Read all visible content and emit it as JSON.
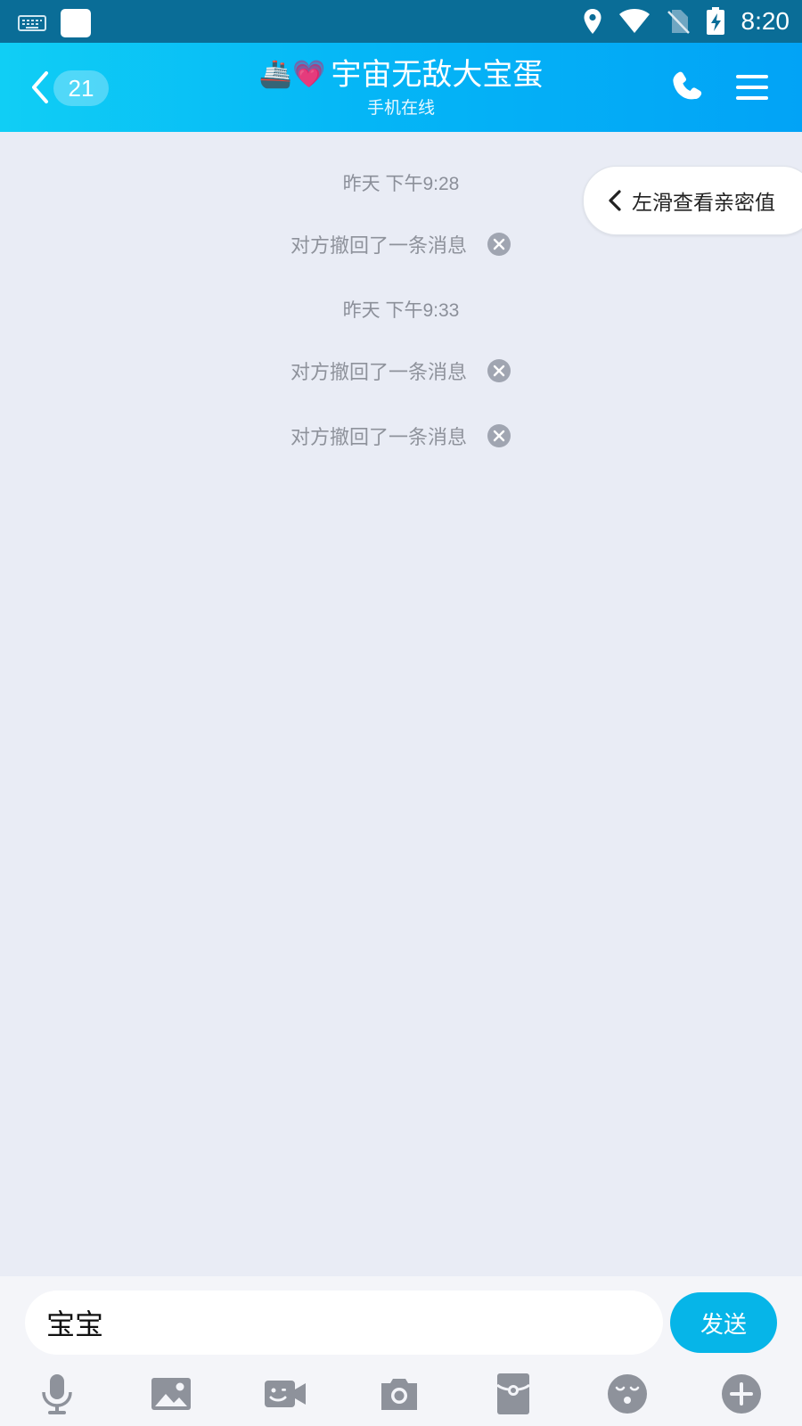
{
  "status_bar": {
    "time": "8:20",
    "icons": [
      "keyboard-icon",
      "app-square-icon",
      "location-icon",
      "wifi-icon",
      "no-sim-icon",
      "battery-charging-icon"
    ]
  },
  "header": {
    "unread_count": "21",
    "title_emoji": "🚢💗",
    "title": "宇宙无敌大宝蛋",
    "subtitle": "手机在线",
    "icons": [
      "back-arrow-icon",
      "phone-icon",
      "menu-icon"
    ]
  },
  "chat": {
    "intimacy_hint": "左滑查看亲密值",
    "messages": [
      {
        "type": "timestamp",
        "text": "昨天 下午9:28"
      },
      {
        "type": "recall",
        "text": "对方撤回了一条消息"
      },
      {
        "type": "timestamp",
        "text": "昨天 下午9:33"
      },
      {
        "type": "recall",
        "text": "对方撤回了一条消息"
      },
      {
        "type": "recall",
        "text": "对方撤回了一条消息"
      }
    ]
  },
  "composer": {
    "input_value": "宝宝",
    "send_label": "发送",
    "tools": [
      "microphone-icon",
      "image-icon",
      "video-call-icon",
      "camera-icon",
      "red-packet-icon",
      "emoji-icon",
      "plus-icon"
    ]
  },
  "colors": {
    "header_start": "#10cef5",
    "header_end": "#02a3f6",
    "status_bar": "#0a6d97",
    "chat_bg": "#e9ecf5",
    "send_button": "#06b5e8",
    "icon_gray": "#8e929b"
  }
}
